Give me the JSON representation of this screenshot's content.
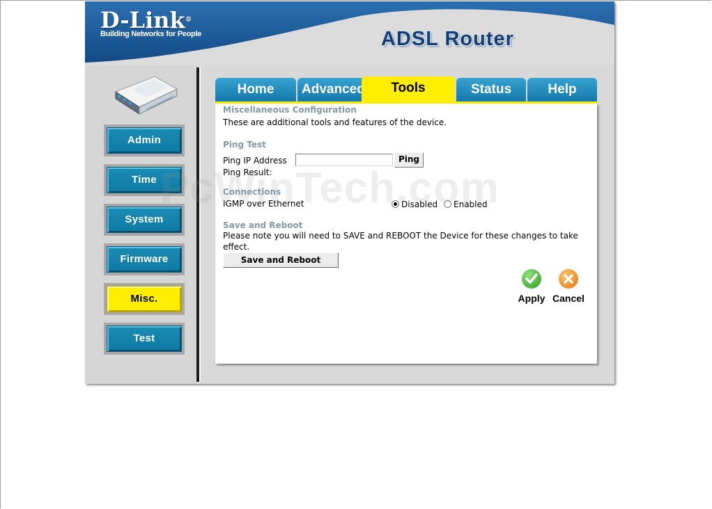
{
  "header": {
    "brand": "D-Link",
    "brand_mark": "®",
    "tagline": "Building Networks for People",
    "product": "ADSL Router"
  },
  "sidebar": {
    "device_image": "router-icon",
    "items": [
      {
        "label": "Admin",
        "active": false
      },
      {
        "label": "Time",
        "active": false
      },
      {
        "label": "System",
        "active": false
      },
      {
        "label": "Firmware",
        "active": false
      },
      {
        "label": "Misc.",
        "active": true
      },
      {
        "label": "Test",
        "active": false
      }
    ]
  },
  "tabs": [
    {
      "label": "Home",
      "active": false
    },
    {
      "label": "Advanced",
      "active": false
    },
    {
      "label": "Tools",
      "active": true
    },
    {
      "label": "Status",
      "active": false
    },
    {
      "label": "Help",
      "active": false
    }
  ],
  "content": {
    "title": "Miscellaneous Configuration",
    "description": "These are additional tools and features of the device.",
    "ping": {
      "title": "Ping Test",
      "ip_label": "Ping IP Address",
      "ip_value": "",
      "button": "Ping",
      "result_label": "Ping Result:"
    },
    "connections": {
      "title": "Connections",
      "igmp_label": "IGMP over Ethernet",
      "options": [
        {
          "label": "Disabled",
          "checked": true
        },
        {
          "label": "Enabled",
          "checked": false
        }
      ]
    },
    "save": {
      "title": "Save and Reboot",
      "note": "Please note you will need to SAVE and REBOOT the Device for these changes to take",
      "note_cont": "effect.",
      "button": "Save and Reboot"
    },
    "actions": {
      "apply": "Apply",
      "cancel": "Cancel"
    }
  },
  "watermark": "PcWinTech.com",
  "colors": {
    "brand_blue": "#1a5c9c",
    "tab_blue": "#1c86bc",
    "active_yellow": "#ffee00",
    "section_gray": "#8398a8",
    "apply_green": "#3aa82a",
    "cancel_orange": "#ec8a18"
  }
}
